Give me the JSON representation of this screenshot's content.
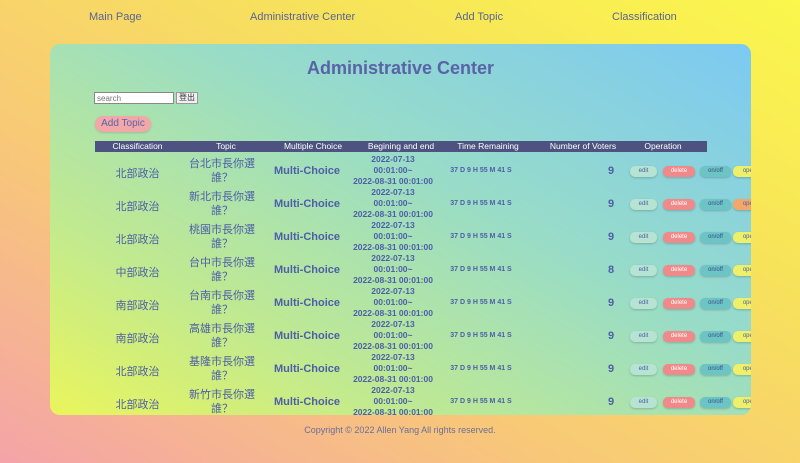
{
  "nav": {
    "main": "Main Page",
    "admin": "Administrative Center",
    "add": "Add Topic",
    "classification": "Classification"
  },
  "page": {
    "title": "Administrative Center"
  },
  "search": {
    "placeholder": "search"
  },
  "logout_label": "登出",
  "add_topic_label": "Add Topic",
  "table": {
    "headers": [
      "Classification",
      "Topic",
      "Multiple Choice",
      "Begining and end",
      "Time Remaining",
      "Number of Voters",
      "Operation"
    ],
    "rows": [
      {
        "classification": "北部政治",
        "topic": "台北市長你選誰？",
        "type": "Multi-Choice",
        "start": "2022-07-13",
        "start_time": "00:01:00~",
        "end": "2022-08-31 00:01:00",
        "remaining": "37 D 9 H 55 M 41 S",
        "voters": "9",
        "edit": "edit",
        "delete": "delete",
        "onoff": "on/off",
        "open": "open/secret",
        "open_color": "#eef06a"
      },
      {
        "classification": "北部政治",
        "topic": "新北市長你選誰？",
        "type": "Multi-Choice",
        "start": "2022-07-13",
        "start_time": "00:01:00~",
        "end": "2022-08-31 00:01:00",
        "remaining": "37 D 9 H 55 M 41 S",
        "voters": "9",
        "edit": "edit",
        "delete": "delete",
        "onoff": "on/off",
        "open": "open/secret",
        "open_color": "#f2a86a"
      },
      {
        "classification": "北部政治",
        "topic": "桃園市長你選誰？",
        "type": "Multi-Choice",
        "start": "2022-07-13",
        "start_time": "00:01:00~",
        "end": "2022-08-31 00:01:00",
        "remaining": "37 D 9 H 55 M 41 S",
        "voters": "9",
        "edit": "edit",
        "delete": "delete",
        "onoff": "on/off",
        "open": "open/secret",
        "open_color": "#eef06a"
      },
      {
        "classification": "中部政治",
        "topic": "台中市長你選誰？",
        "type": "Multi-Choice",
        "start": "2022-07-13",
        "start_time": "00:01:00~",
        "end": "2022-08-31 00:01:00",
        "remaining": "37 D 9 H 55 M 41 S",
        "voters": "8",
        "edit": "edit",
        "delete": "delete",
        "onoff": "on/off",
        "open": "open/secret",
        "open_color": "#eef06a"
      },
      {
        "classification": "南部政治",
        "topic": "台南市長你選誰？",
        "type": "Multi-Choice",
        "start": "2022-07-13",
        "start_time": "00:01:00~",
        "end": "2022-08-31 00:01:00",
        "remaining": "37 D 9 H 55 M 41 S",
        "voters": "9",
        "edit": "edit",
        "delete": "delete",
        "onoff": "on/off",
        "open": "open/secret",
        "open_color": "#eef06a"
      },
      {
        "classification": "南部政治",
        "topic": "高雄市長你選誰？",
        "type": "Multi-Choice",
        "start": "2022-07-13",
        "start_time": "00:01:00~",
        "end": "2022-08-31 00:01:00",
        "remaining": "37 D 9 H 55 M 41 S",
        "voters": "9",
        "edit": "edit",
        "delete": "delete",
        "onoff": "on/off",
        "open": "open/secret",
        "open_color": "#eef06a"
      },
      {
        "classification": "北部政治",
        "topic": "基隆市長你選誰？",
        "type": "Multi-Choice",
        "start": "2022-07-13",
        "start_time": "00:01:00~",
        "end": "2022-08-31 00:01:00",
        "remaining": "37 D 9 H 55 M 41 S",
        "voters": "9",
        "edit": "edit",
        "delete": "delete",
        "onoff": "on/off",
        "open": "open/secret",
        "open_color": "#eef06a"
      },
      {
        "classification": "北部政治",
        "topic": "新竹市長你選誰？",
        "type": "Multi-Choice",
        "start": "2022-07-13",
        "start_time": "00:01:00~",
        "end": "2022-08-31 00:01:00",
        "remaining": "37 D 9 H 55 M 41 S",
        "voters": "9",
        "edit": "edit",
        "delete": "delete",
        "onoff": "on/off",
        "open": "open/secret",
        "open_color": "#eef06a"
      }
    ]
  },
  "footer": {
    "copyright": "Copyright © 2022 Allen Yang All rights reserved."
  }
}
